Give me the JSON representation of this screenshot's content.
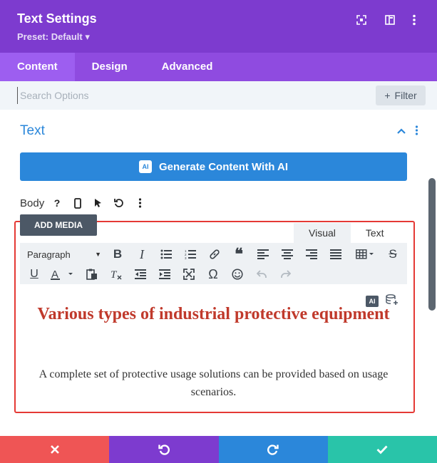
{
  "header": {
    "title": "Text Settings",
    "preset": "Preset: Default ▾",
    "icons": [
      "expand-icon",
      "sidebar-layout-icon",
      "more-vertical-icon"
    ]
  },
  "tabs": [
    {
      "label": "Content",
      "active": true
    },
    {
      "label": "Design",
      "active": false
    },
    {
      "label": "Advanced",
      "active": false
    }
  ],
  "search": {
    "placeholder": "Search Options",
    "value": "",
    "filter_label": "Filter"
  },
  "section": {
    "title": "Text",
    "ai_button_label": "Generate Content With AI",
    "ai_badge": "AI"
  },
  "body_row": {
    "label": "Body",
    "help": "?"
  },
  "editor": {
    "add_media": "ADD MEDIA",
    "tab_visual": "Visual",
    "tab_text": "Text",
    "format_select": "Paragraph",
    "ai_mini": "AI",
    "heading": "Various types of industrial protective equipment",
    "paragraph": "A complete set of protective usage solutions can be provided based on usage scenarios."
  },
  "colors": {
    "header_purple": "#7d3bcf",
    "accent_blue": "#2b87da",
    "heading_red": "#c0392b",
    "cancel_red": "#ef5555",
    "save_green": "#29c4a9",
    "highlight_border": "#e53935"
  }
}
